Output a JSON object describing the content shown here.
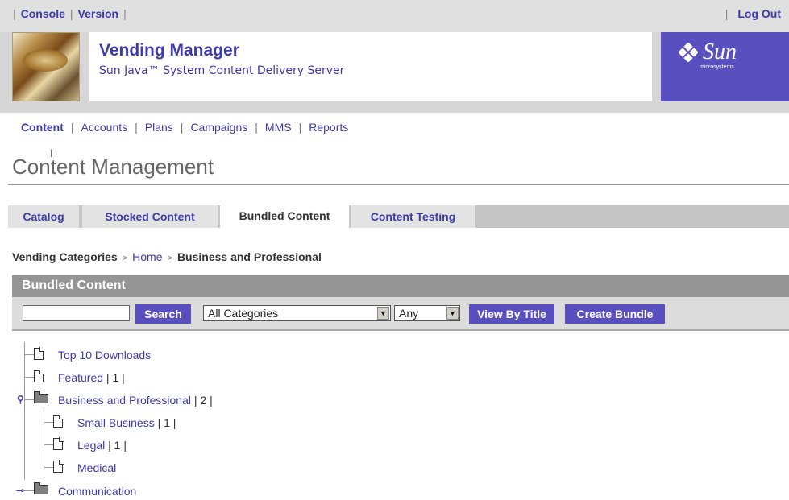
{
  "masthead": {
    "nav": [
      "Console",
      "Version"
    ],
    "logout": "Log Out",
    "app_title": "Vending Manager",
    "app_subtitle": "Sun Java™ System Content Delivery Server",
    "brand_word": "Sun",
    "brand_small": "microsystems",
    "brand_color": "#594fbf"
  },
  "section_nav": {
    "items": [
      "Content",
      "Accounts",
      "Plans",
      "Campaigns",
      "MMS",
      "Reports"
    ],
    "active": "Content"
  },
  "page": {
    "heading": "Content Management"
  },
  "tabs": [
    {
      "label": "Catalog"
    },
    {
      "label": "Stocked Content"
    },
    {
      "label": "Bundled Content",
      "selected": true
    },
    {
      "label": "Content Testing"
    }
  ],
  "breadcrumb": {
    "root": "Vending Categories",
    "sep": ">",
    "home": "Home",
    "current": "Business and Professional"
  },
  "panel": {
    "title": "Bundled Content",
    "search_value": "",
    "search_button": "Search",
    "category_select": "All Categories",
    "type_select": "Any",
    "view_button": "View By Title",
    "create_button": "Create Bundle"
  },
  "tree": [
    {
      "label": "Top 10 Downloads",
      "count": "",
      "icon": "document-icon"
    },
    {
      "label": "Featured",
      "count": " | 1 |",
      "icon": "document-icon"
    },
    {
      "label": "Business and Professional",
      "count": " | 2 |",
      "icon": "folder-icon",
      "expanded": true
    },
    {
      "label": "Small Business",
      "count": " | 1 |",
      "icon": "document-icon"
    },
    {
      "label": "Legal",
      "count": " | 1 |",
      "icon": "document-icon"
    },
    {
      "label": "Medical",
      "count": "",
      "icon": "document-icon"
    },
    {
      "label": "Communication",
      "count": "",
      "icon": "folder-icon",
      "expanded": false
    }
  ]
}
